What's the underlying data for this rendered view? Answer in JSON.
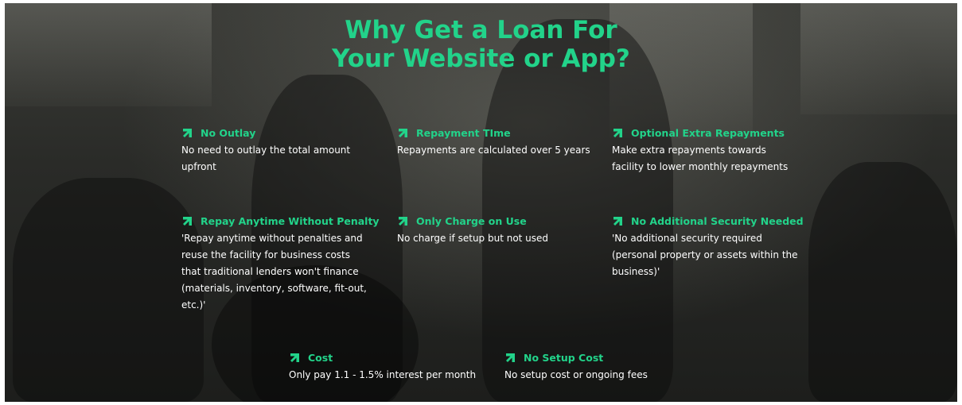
{
  "colors": {
    "accent": "#22d38a",
    "text": "#ffffff"
  },
  "hero": {
    "title_line1": "Why Get a Loan For",
    "title_line2": "Your Website or App?"
  },
  "features": [
    {
      "icon": "arrow-up-right-icon",
      "title": "No Outlay",
      "desc": "No need to outlay the total amount upfront"
    },
    {
      "icon": "arrow-up-right-icon",
      "title": "Repayment TIme",
      "desc": "Repayments are calculated over 5 years"
    },
    {
      "icon": "arrow-up-right-icon",
      "title": "Optional Extra Repayments",
      "desc": "Make extra repayments towards facility to lower monthly repayments"
    },
    {
      "icon": "arrow-up-right-icon",
      "title": "Repay Anytime Without Penalty",
      "desc": "'Repay anytime without penalties and reuse the facility for business costs that traditional lenders won't finance (materials, inventory, software, fit-out, etc.)'"
    },
    {
      "icon": "arrow-up-right-icon",
      "title": "Only Charge on Use",
      "desc": "No charge if setup but not used"
    },
    {
      "icon": "arrow-up-right-icon",
      "title": "No Additional Security Needed",
      "desc": "'No additional security required (personal property or assets within the business)'"
    },
    {
      "icon": "arrow-up-right-icon",
      "title": "Cost",
      "desc": "Only pay 1.1 - 1.5% interest per month"
    },
    {
      "icon": "arrow-up-right-icon",
      "title": "No Setup Cost",
      "desc": "No setup cost or ongoing fees"
    }
  ]
}
